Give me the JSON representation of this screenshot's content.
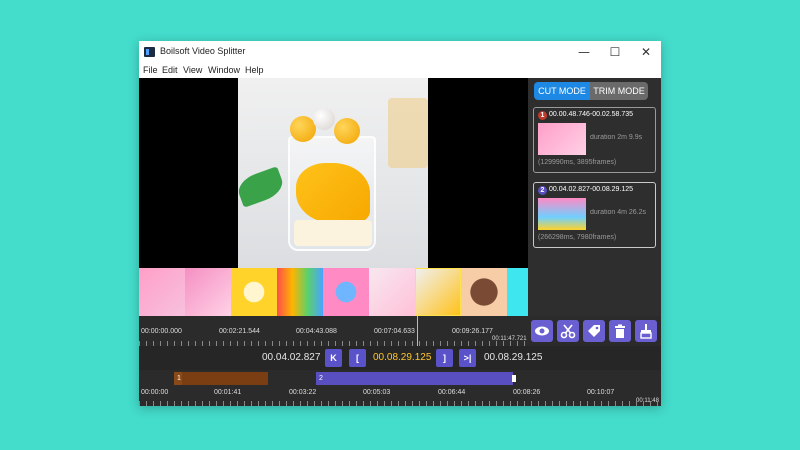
{
  "window": {
    "title": "Boilsoft Video Splitter",
    "controls": {
      "minimize": "—",
      "maximize": "☐",
      "close": "✕"
    }
  },
  "menu": [
    "File",
    "Edit",
    "View",
    "Window",
    "Help"
  ],
  "modes": {
    "cut": "CUT MODE",
    "trim": "TRIM MODE",
    "active": "cut"
  },
  "segments": [
    {
      "number": "1",
      "range": "00.00.48.746-00.02.58.735",
      "duration": "duration 2m 9.9s",
      "detail": "(129990ms, 3895frames)",
      "badge_color": "#c0392b"
    },
    {
      "number": "2",
      "range": "00.04.02.827-00.08.29.125",
      "duration": "duration 4m 26.2s",
      "detail": "(266298ms, 7980frames)",
      "badge_color": "#5a4fc0"
    }
  ],
  "preview_timeline": {
    "labels": [
      "00:00:00.000",
      "00:02:21.544",
      "00:04:43.088",
      "00:07:04.633",
      "00:09:26.177"
    ],
    "end": "00:11:47.721"
  },
  "tools": [
    "eye-icon",
    "scissors-icon",
    "tag-icon",
    "trash-icon",
    "broom-icon"
  ],
  "controls": {
    "start_time": "00.04.02.827",
    "prev": "K",
    "mark_in": "[",
    "current_time": "00.08.29.125",
    "mark_out": "]",
    "next": ">|",
    "end_time": "00.08.29.125"
  },
  "main_timeline": {
    "segment1_label": "1",
    "segment2_label": "2",
    "labels": [
      "00:00:00",
      "00:01:41",
      "00:03:22",
      "00:05:03",
      "00:06:44",
      "00:08:26",
      "00:10:07"
    ],
    "end": "00:11:48"
  }
}
